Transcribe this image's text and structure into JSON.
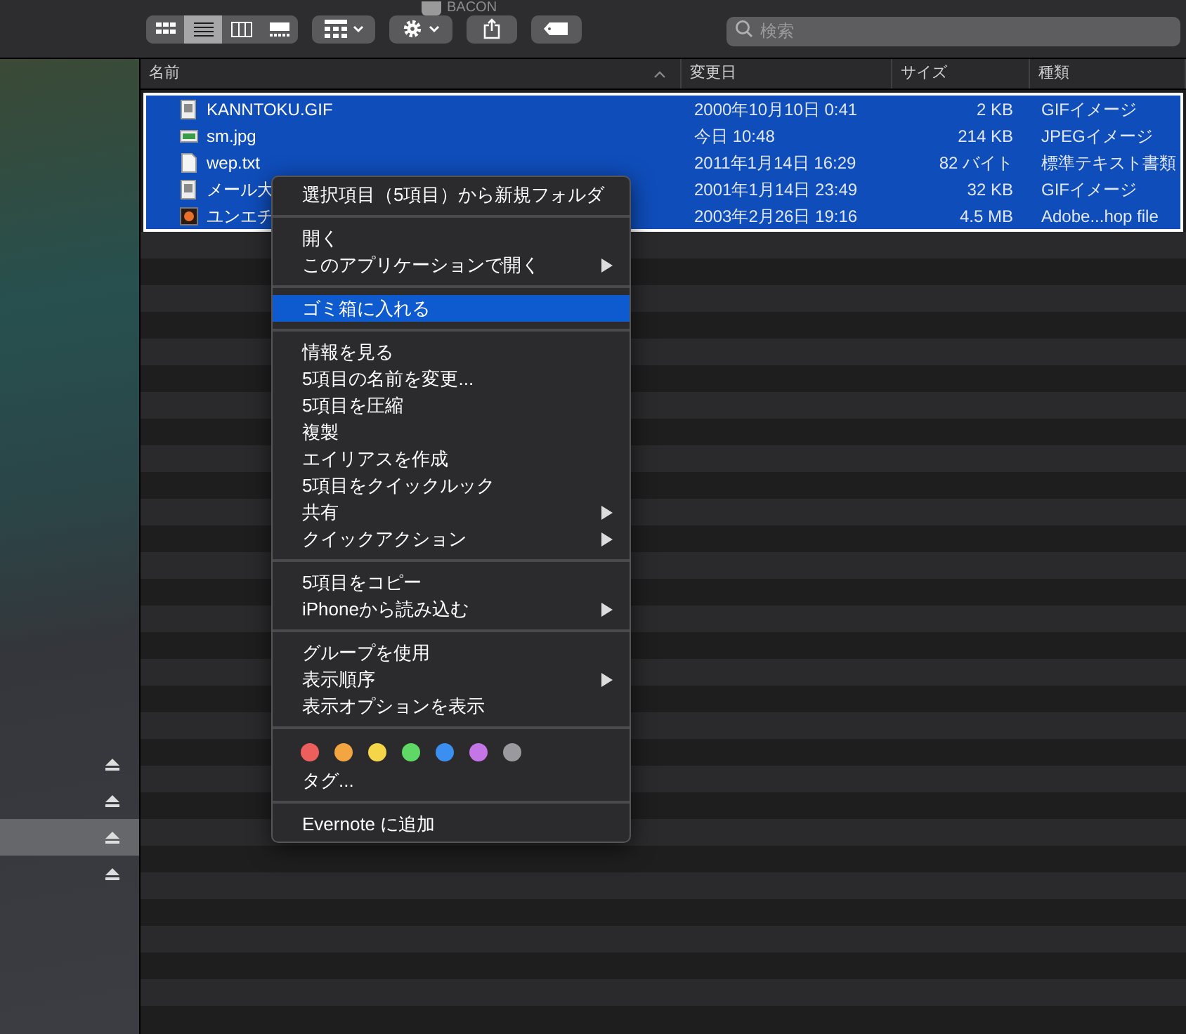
{
  "window": {
    "title": "BACON"
  },
  "toolbar": {
    "view_modes": [
      {
        "kind": "icons",
        "selected": false
      },
      {
        "kind": "list",
        "selected": true
      },
      {
        "kind": "columns",
        "selected": false
      },
      {
        "kind": "gallery",
        "selected": false
      }
    ],
    "search": {
      "placeholder": "検索"
    }
  },
  "sidebar": {
    "items": [
      {
        "selected": false
      },
      {
        "selected": false
      },
      {
        "selected": true
      },
      {
        "selected": false
      }
    ]
  },
  "table": {
    "columns": [
      {
        "label": "名前",
        "sorted": true
      },
      {
        "label": "変更日",
        "sorted": false
      },
      {
        "label": "サイズ",
        "sorted": false
      },
      {
        "label": "種類",
        "sorted": false
      }
    ],
    "rows": [
      {
        "kind": "gif",
        "name": "KANNTOKU.GIF",
        "modified": "2000年10月10日 0:41",
        "size": "2 KB",
        "type": "GIFイメージ",
        "selected": true
      },
      {
        "kind": "jpeg",
        "name": "sm.jpg",
        "modified": "今日 10:48",
        "size": "214 KB",
        "type": "JPEGイメージ",
        "selected": true
      },
      {
        "kind": "text",
        "name": "wep.txt",
        "modified": "2011年1月14日 16:29",
        "size": "82 バイト",
        "type": "標準テキスト書類",
        "selected": true
      },
      {
        "kind": "gif",
        "name": "メール大",
        "modified": "2001年1月14日 23:49",
        "size": "32 KB",
        "type": "GIFイメージ",
        "selected": true
      },
      {
        "kind": "psd",
        "name": "ユンエチ",
        "modified": "2003年2月26日 19:16",
        "size": "4.5 MB",
        "type": "Adobe...hop file",
        "selected": true
      }
    ]
  },
  "context_menu": {
    "sections": [
      {
        "items": [
          {
            "kind": "item",
            "label": "選択項目（5項目）から新規フォルダ",
            "submenu": false,
            "selected": false
          }
        ]
      },
      {
        "items": [
          {
            "kind": "item",
            "label": "開く",
            "submenu": false,
            "selected": false
          },
          {
            "kind": "item",
            "label": "このアプリケーションで開く",
            "submenu": true,
            "selected": false
          }
        ]
      },
      {
        "items": [
          {
            "kind": "item",
            "label": "ゴミ箱に入れる",
            "submenu": false,
            "selected": true
          }
        ]
      },
      {
        "items": [
          {
            "kind": "item",
            "label": "情報を見る",
            "submenu": false,
            "selected": false
          },
          {
            "kind": "item",
            "label": "5項目の名前を変更...",
            "submenu": false,
            "selected": false
          },
          {
            "kind": "item",
            "label": "5項目を圧縮",
            "submenu": false,
            "selected": false
          },
          {
            "kind": "item",
            "label": "複製",
            "submenu": false,
            "selected": false
          },
          {
            "kind": "item",
            "label": "エイリアスを作成",
            "submenu": false,
            "selected": false
          },
          {
            "kind": "item",
            "label": "5項目をクイックルック",
            "submenu": false,
            "selected": false
          },
          {
            "kind": "item",
            "label": "共有",
            "submenu": true,
            "selected": false
          },
          {
            "kind": "item",
            "label": "クイックアクション",
            "submenu": true,
            "selected": false
          }
        ]
      },
      {
        "items": [
          {
            "kind": "item",
            "label": "5項目をコピー",
            "submenu": false,
            "selected": false
          },
          {
            "kind": "item",
            "label": "iPhoneから読み込む",
            "submenu": true,
            "selected": false
          }
        ]
      },
      {
        "items": [
          {
            "kind": "item",
            "label": "グループを使用",
            "submenu": false,
            "selected": false
          },
          {
            "kind": "item",
            "label": "表示順序",
            "submenu": true,
            "selected": false
          },
          {
            "kind": "item",
            "label": "表示オプションを表示",
            "submenu": false,
            "selected": false
          }
        ]
      },
      {
        "items": [
          {
            "kind": "tags",
            "tags": [
              {
                "color": "#ec5f5d"
              },
              {
                "color": "#f2a540"
              },
              {
                "color": "#f5d648"
              },
              {
                "color": "#5fd866"
              },
              {
                "color": "#3b8ff0"
              },
              {
                "color": "#c576e6"
              },
              {
                "color": "#9a9a9e"
              }
            ]
          },
          {
            "kind": "item",
            "label": "タグ...",
            "submenu": false,
            "selected": false
          }
        ]
      },
      {
        "items": [
          {
            "kind": "item",
            "label": "Evernote に追加",
            "submenu": false,
            "selected": false
          }
        ]
      }
    ]
  }
}
